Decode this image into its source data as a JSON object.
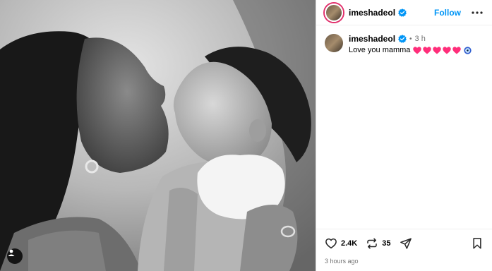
{
  "post": {
    "username": "imeshadeol",
    "follow_label": "Follow",
    "caption_time": "3 h",
    "caption_text": "Love you mamma",
    "caption_emojis": [
      "pink-heart",
      "pink-heart",
      "pink-heart",
      "pink-heart",
      "pink-heart",
      "nazar-amulet"
    ],
    "likes": "2.4K",
    "reposts": "35",
    "posted": "3 hours ago"
  },
  "colors": {
    "accent": "#0095f6",
    "verified": "#0095f6",
    "heart": "#ff2e7a",
    "muted": "#737373"
  },
  "photo": {
    "description_kind": "black-and-white photograph"
  }
}
